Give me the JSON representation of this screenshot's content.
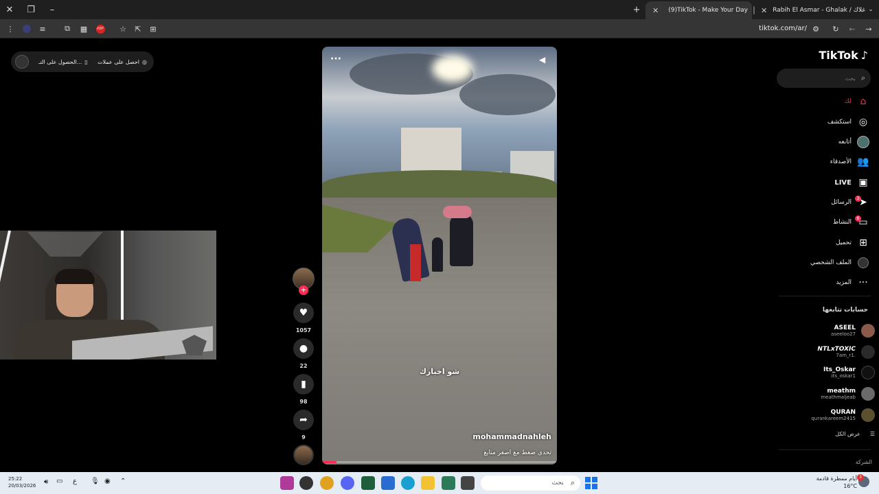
{
  "browser": {
    "tabs": [
      {
        "title": "(9)TikTok - Make Your Day",
        "active": true
      },
      {
        "title": "Rabih El Asmar - Ghalak / غلاك",
        "active": false
      }
    ],
    "url": "tiktok.com/ar/"
  },
  "coins": {
    "get_coins": "احصل على عملات",
    "get_app": "الحصول على التـ..."
  },
  "video": {
    "caption_overlay": "شو اخبارك",
    "author": "mohammadnahleh",
    "description": "تحدي ضغط مع اصغر متابع"
  },
  "actions": {
    "likes": "1057",
    "comments": "22",
    "saves": "98",
    "shares": "9"
  },
  "sidebar": {
    "logo": "TikTok",
    "search_placeholder": "بحث",
    "nav": [
      {
        "label": "لك",
        "icon": "home-icon"
      },
      {
        "label": "استكشف",
        "icon": "compass-icon"
      },
      {
        "label": "أتابعه",
        "icon": "following-icon"
      },
      {
        "label": "الأصدقاء",
        "icon": "friends-icon"
      },
      {
        "label": "LIVE",
        "icon": "live-icon"
      },
      {
        "label": "الرسائل",
        "icon": "messages-icon",
        "badge": "3"
      },
      {
        "label": "النشاط",
        "icon": "activity-icon",
        "badge": "6"
      },
      {
        "label": "تحميل",
        "icon": "upload-icon"
      },
      {
        "label": "الملف الشخصي",
        "icon": "profile-icon"
      },
      {
        "label": "المزيد",
        "icon": "more-icon"
      }
    ],
    "following_title": "حسابات تتابعها",
    "following": [
      {
        "name": "ASEEL",
        "handle": "aseeloo27"
      },
      {
        "name": "NTLxTOXIC",
        "handle": "7am_r1."
      },
      {
        "name": "Its_Oskar",
        "handle": "its_oskar1"
      },
      {
        "name": "meathm",
        "handle": "meathmaljeab"
      },
      {
        "name": "QURAN",
        "handle": "qurankareem2415"
      }
    ],
    "see_all": "عرض الكل",
    "company": "الشركة"
  },
  "taskbar": {
    "time": "25:22",
    "date": "20/03/2026",
    "lang": "ع",
    "search": "بحث",
    "weather_text": "أيام ممطرة قادمة",
    "weather_temp": "16°C",
    "weather_badge": "3"
  },
  "colors": {
    "accent": "#fe2c55",
    "taskbar_bg": "#e6ecf3",
    "sidebar_bg": "#000000"
  }
}
